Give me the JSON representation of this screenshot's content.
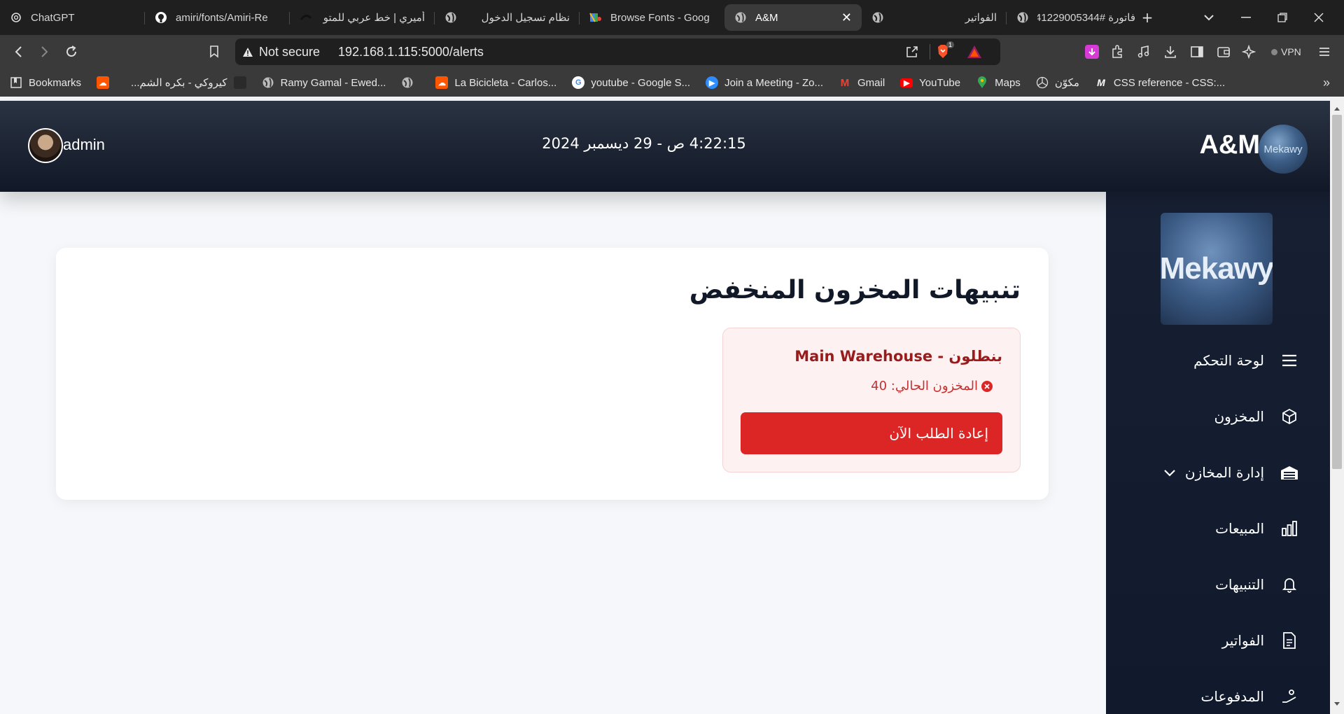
{
  "tabs": [
    {
      "title": "ChatGPT",
      "icon": "chatgpt-icon"
    },
    {
      "title": "amiri/fonts/Amiri-Re",
      "icon": "github-icon"
    },
    {
      "title": "أميري | خط عربي للمتو",
      "icon": "site-icon"
    },
    {
      "title": "نظام تسجيل الدخول",
      "icon": "globe-icon"
    },
    {
      "title": "Browse Fonts - Goog",
      "icon": "google-fonts-icon"
    },
    {
      "title": "A&M",
      "icon": "globe-icon",
      "active": true
    },
    {
      "title": "الفواتير",
      "icon": "globe-icon"
    },
    {
      "title": "فاتورة #41229005344",
      "icon": "globe-icon"
    }
  ],
  "toolbar": {
    "security_label": "Not secure",
    "url": "192.168.1.115:5000/alerts",
    "vpn_label": "VPN",
    "brave_badge": "1"
  },
  "bookmarks": [
    {
      "label": "Bookmarks",
      "icon": "bookmarks-icon"
    },
    {
      "label": "",
      "icon": "soundcloud-icon"
    },
    {
      "label": "كيروكي - بكره الشم...",
      "icon": "site-icon"
    },
    {
      "label": "Ramy Gamal - Ewed...",
      "icon": "globe-icon"
    },
    {
      "label": "",
      "icon": "globe-icon"
    },
    {
      "label": "La Bicicleta - Carlos...",
      "icon": "soundcloud-icon"
    },
    {
      "label": "youtube - Google S...",
      "icon": "google-icon"
    },
    {
      "label": "Join a Meeting - Zo...",
      "icon": "zoom-icon"
    },
    {
      "label": "Gmail",
      "icon": "gmail-icon"
    },
    {
      "label": "YouTube",
      "icon": "youtube-icon"
    },
    {
      "label": "Maps",
      "icon": "maps-icon"
    },
    {
      "label": "مكوّن",
      "icon": "mercedes-icon"
    },
    {
      "label": "CSS reference - CSS:...",
      "icon": "mdn-icon"
    }
  ],
  "header": {
    "username": "admin",
    "datetime": "4:22:15 ص - 29 ديسمبر 2024",
    "brand": "A&M",
    "brand_logo_text": "Mekawy"
  },
  "sidebar": {
    "logo_text": "Mekawy",
    "items": [
      {
        "label": "لوحة التحكم",
        "icon": "menu-icon"
      },
      {
        "label": "المخزون",
        "icon": "box-icon"
      },
      {
        "label": "إدارة المخازن",
        "icon": "warehouse-icon"
      },
      {
        "label": "المبيعات",
        "icon": "bar-chart-icon"
      },
      {
        "label": "التنبيهات",
        "icon": "bell-icon"
      },
      {
        "label": "الفواتير",
        "icon": "document-icon"
      },
      {
        "label": "المدفوعات",
        "icon": "payments-icon"
      }
    ]
  },
  "main": {
    "title": "تنبيهات المخزون المنخفض",
    "alert": {
      "name": "بنطلون - Main Warehouse",
      "stock_text": "المخزون الحالي: 40",
      "button_label": "إعادة الطلب الآن"
    }
  },
  "colors": {
    "header_bg": "#1a2332",
    "sidebar_bg": "#152033",
    "alert_bg": "#fdf1f1",
    "alert_text": "#991b1b",
    "button_bg": "#dc2626",
    "page_bg": "#f5f7fa"
  }
}
